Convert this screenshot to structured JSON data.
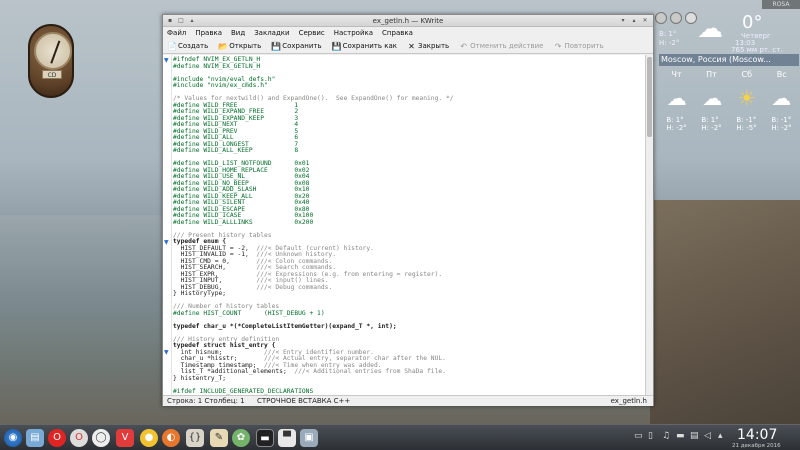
{
  "desktop": {
    "top_indicator": "ROSA",
    "clock_widget": {
      "label": "CD"
    },
    "weather": {
      "current_temp": "0°",
      "low_high": "В: 1°\nН: -2°",
      "date_line1": "Четверг",
      "date_line2": "21 декабря 2016",
      "time_small": "13:03",
      "pressure": "765 мм рт. ст.",
      "city": "Moscow, Россия (Moscow...",
      "days": [
        "Чт",
        "Пт",
        "Сб",
        "Вс"
      ],
      "day_icons": [
        "cloud-snow-icon",
        "cloud-snow-icon",
        "sun-cloud-icon",
        "cloud-snow-icon"
      ],
      "day_temps": [
        "В: 1°\nН: -2°",
        "В: 1°\nН: -2°",
        "В: -1°\nН: -5°",
        "В: -1°\nН: -2°"
      ]
    }
  },
  "window": {
    "title": "ex_getln.h — KWrite",
    "menu": [
      "Файл",
      "Правка",
      "Вид",
      "Закладки",
      "Сервис",
      "Настройка",
      "Справка"
    ],
    "toolbar": {
      "create": "Создать",
      "open": "Открыть",
      "save": "Сохранить",
      "save_as": "Сохранить как",
      "close": "Закрыть",
      "undo": "Отменить действие",
      "redo": "Повторить"
    },
    "code_lines": [
      "#ifndef NVIM_EX_GETLN_H",
      "#define NVIM_EX_GETLN_H",
      "",
      "#include \"nvim/eval_defs.h\"",
      "#include \"nvim/ex_cmds.h\"",
      "",
      "/* Values for nextwild() and ExpandOne().  See ExpandOne() for meaning. */",
      "#define WILD_FREE               1",
      "#define WILD_EXPAND_FREE        2",
      "#define WILD_EXPAND_KEEP        3",
      "#define WILD_NEXT               4",
      "#define WILD_PREV               5",
      "#define WILD_ALL                6",
      "#define WILD_LONGEST            7",
      "#define WILD_ALL_KEEP           8",
      "",
      "#define WILD_LIST_NOTFOUND      0x01",
      "#define WILD_HOME_REPLACE       0x02",
      "#define WILD_USE_NL             0x04",
      "#define WILD_NO_BEEP            0x08",
      "#define WILD_ADD_SLASH          0x10",
      "#define WILD_KEEP_ALL           0x20",
      "#define WILD_SILENT             0x40",
      "#define WILD_ESCAPE             0x80",
      "#define WILD_ICASE              0x100",
      "#define WILD_ALLLINKS           0x200",
      "",
      "/// Present history tables",
      "typedef enum {",
      "  HIST_DEFAULT = -2,  ///< Default (current) history.",
      "  HIST_INVALID = -1,  ///< Unknown history.",
      "  HIST_CMD = 0,       ///< Colon commands.",
      "  HIST_SEARCH,        ///< Search commands.",
      "  HIST_EXPR,          ///< Expressions (e.g. from entering = register).",
      "  HIST_INPUT,         ///< input() lines.",
      "  HIST_DEBUG,         ///< Debug commands.",
      "} HistoryType;",
      "",
      "/// Number of history tables",
      "#define HIST_COUNT      (HIST_DEBUG + 1)",
      "",
      "typedef char_u *(*CompleteListItemGetter)(expand_T *, int);",
      "",
      "/// History entry definition",
      "typedef struct hist_entry {",
      "  int hisnum;           ///< Entry identifier number.",
      "  char_u *hisstr;       ///< Actual entry, separator char after the NUL.",
      "  Timestamp timestamp;  ///< Time when entry was added.",
      "  list_T *additional_elements;  ///< Additional entries from ShaDa file.",
      "} histentry_T;",
      "",
      "#ifdef INCLUDE_GENERATED_DECLARATIONS"
    ],
    "status": {
      "position": "Строка: 1 Столбец: 1",
      "mode": "СТРОЧНОЕ  ВСТАВКА  C++",
      "file": "ex_getln.h"
    }
  },
  "taskbar": {
    "clock_time": "14:07",
    "clock_date": "21 декабря 2016"
  }
}
